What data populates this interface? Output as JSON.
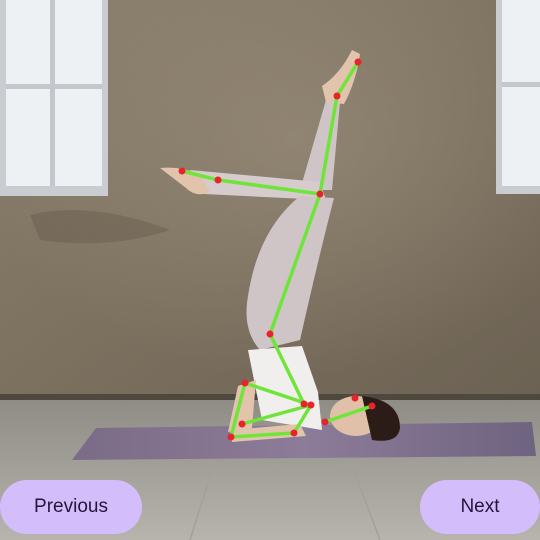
{
  "photo": {
    "subject": "person-doing-shoulderstand-yoga-pose",
    "overlay_line_color": "#6fe53a",
    "overlay_point_color": "#e8232e"
  },
  "navigation": {
    "previous_label": "Previous",
    "next_label": "Next"
  },
  "colors": {
    "button_background": "#d4bdfb",
    "button_text": "#24163a"
  }
}
